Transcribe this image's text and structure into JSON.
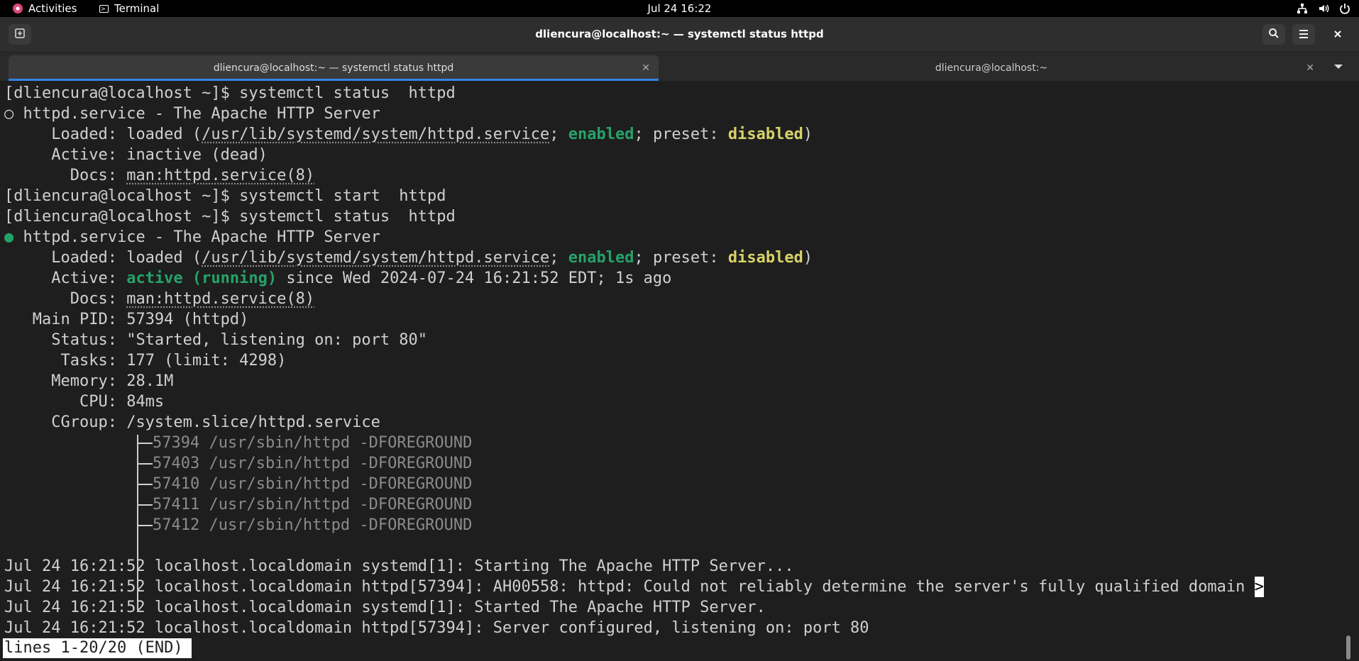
{
  "topbar": {
    "activities": "Activities",
    "app_name": "Terminal",
    "clock": "Jul 24  16:22",
    "tray_icons": [
      "network-icon",
      "volume-icon",
      "power-icon"
    ]
  },
  "window": {
    "title": "dliencura@localhost:~ — systemctl status httpd"
  },
  "tabs": [
    {
      "label": "dliencura@localhost:~ — systemctl status httpd",
      "active": true
    },
    {
      "label": "dliencura@localhost:~",
      "active": false
    }
  ],
  "terminal": {
    "prompt": "[dliencura@localhost ~]$ ",
    "cmd1": "systemctl status  httpd",
    "svc1_title": "httpd.service - The Apache HTTP Server",
    "svc1_loaded_label": "Loaded: loaded (",
    "unit_path": "/usr/lib/systemd/system/httpd.service",
    "sep": "; ",
    "enabled": "enabled",
    "preset_label": "; preset: ",
    "disabled": "disabled",
    "close_paren": ")",
    "svc1_active": "Active: inactive (dead)",
    "docs_label": "Docs: ",
    "docs_value": "man:httpd.service(8)",
    "cmd2": "systemctl start  httpd",
    "cmd3": "systemctl status  httpd",
    "svc2_title": "httpd.service - The Apache HTTP Server",
    "active_label": "Active: ",
    "active_value": "active (running)",
    "active_since": " since Wed 2024-07-24 16:21:52 EDT; 1s ago",
    "main_pid": "Main PID: 57394 (httpd)",
    "status": "Status: \"Started, listening on: port 80\"",
    "tasks": "Tasks: 177 (limit: 4298)",
    "memory": "Memory: 28.1M",
    "cpu": "CPU: 84ms",
    "cgroup": "CGroup: /system.slice/httpd.service",
    "processes": [
      "57394 /usr/sbin/httpd -DFOREGROUND",
      "57403 /usr/sbin/httpd -DFOREGROUND",
      "57410 /usr/sbin/httpd -DFOREGROUND",
      "57411 /usr/sbin/httpd -DFOREGROUND",
      "57412 /usr/sbin/httpd -DFOREGROUND"
    ],
    "log": [
      "Jul 24 16:21:52 localhost.localdomain systemd[1]: Starting The Apache HTTP Server...",
      "Jul 24 16:21:52 localhost.localdomain httpd[57394]: AH00558: httpd: Could not reliably determine the server's fully qualified domain ",
      "Jul 24 16:21:52 localhost.localdomain systemd[1]: Started The Apache HTTP Server.",
      "Jul 24 16:21:52 localhost.localdomain httpd[57394]: Server configured, listening on: port 80"
    ],
    "truncation_marker": ">",
    "pager_status": "lines 1-20/20 (END)"
  }
}
